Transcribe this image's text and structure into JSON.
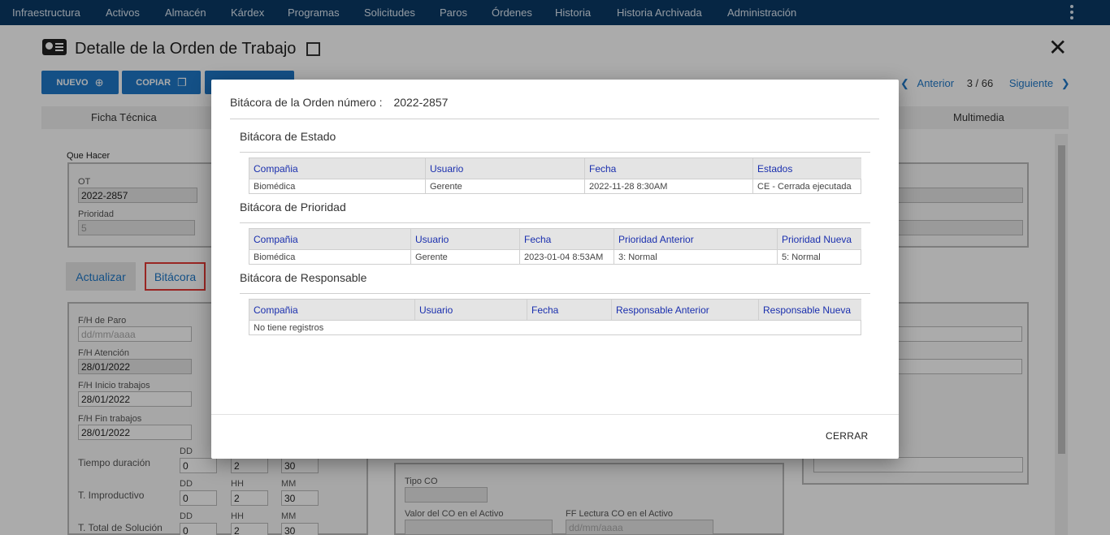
{
  "topnav": {
    "items": [
      "Infraestructura",
      "Activos",
      "Almacén",
      "Kárdex",
      "Programas",
      "Solicitudes",
      "Paros",
      "Órdenes",
      "Historia",
      "Historia Archivada",
      "Administración"
    ]
  },
  "page": {
    "title": "Detalle de la Orden de Trabajo",
    "buttons": {
      "nuevo": "NUEVO",
      "copiar": "COPIAR"
    },
    "pager": {
      "prev": "Anterior",
      "count": "3 / 66",
      "next": "Siguiente"
    },
    "tabs": {
      "ficha": "Ficha Técnica",
      "multimedia": "Multimedia"
    },
    "que_hacer_label": "Que Hacer",
    "ot_label": "OT",
    "ot_value": "2022-2857",
    "prioridad_label": "Prioridad",
    "prioridad_value": "5",
    "btn_actualizar": "Actualizar",
    "btn_bitacora": "Bitácora",
    "fh_paro_label": "F/H de Paro",
    "fh_paro_placeholder": "dd/mm/aaaa",
    "fh_atencion_label": "F/H Atención",
    "fh_atencion_value": "28/01/2022",
    "fh_inicio_label": "F/H Inicio trabajos",
    "fh_inicio_value": "28/01/2022",
    "fh_fin_label": "F/H Fin trabajos",
    "fh_fin_value": "28/01/2022",
    "dd": "DD",
    "hh": "HH",
    "mm": "MM",
    "tiempo_duracion_label": "Tiempo duración",
    "t_improductivo_label": "T. Improductivo",
    "t_total_label": "T. Total de Solución",
    "time_values": {
      "dd": "0",
      "hh": "2",
      "mm": "30"
    },
    "tipo_co_label": "Tipo CO",
    "valor_co_label": "Valor del CO en el Activo",
    "ff_lectura_label": "FF Lectura CO en el Activo",
    "ff_lectura_placeholder": "dd/mm/aaaa"
  },
  "modal": {
    "header_label": "Bitácora de la Orden número :",
    "order_number": "2022-2857",
    "estado": {
      "title": "Bitácora de Estado",
      "columns": [
        "Compañia",
        "Usuario",
        "Fecha",
        "Estados"
      ],
      "rows": [
        [
          "Biomédica",
          "Gerente",
          "2022-11-28 8:30AM",
          "CE - Cerrada ejecutada"
        ]
      ]
    },
    "prioridad": {
      "title": "Bitácora de Prioridad",
      "columns": [
        "Compañia",
        "Usuario",
        "Fecha",
        "Prioridad Anterior",
        "Prioridad Nueva"
      ],
      "rows": [
        [
          "Biomédica",
          "Gerente",
          "2023-01-04 8:53AM",
          "3: Normal",
          "5: Normal"
        ]
      ]
    },
    "responsable": {
      "title": "Bitácora de Responsable",
      "columns": [
        "Compañia",
        "Usuario",
        "Fecha",
        "Responsable Anterior",
        "Responsable Nueva"
      ],
      "empty": "No tiene registros"
    },
    "close_label": "CERRAR"
  },
  "colors": {
    "nav": "#0a3a66",
    "primary": "#1e78c8",
    "table_header_text": "#1a2fae",
    "highlight_border": "#e53935"
  }
}
